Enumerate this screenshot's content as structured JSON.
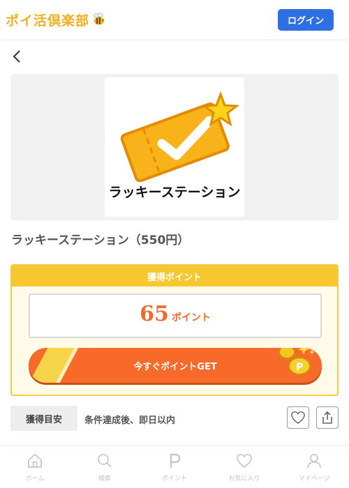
{
  "header": {
    "logo_text": "ポイ活倶楽部",
    "login_label": "ログイン"
  },
  "hero": {
    "caption": "ラッキーステーション"
  },
  "offer": {
    "title": "ラッキーステーション（550円）"
  },
  "points": {
    "heading": "獲得ポイント",
    "value": "65",
    "unit": "ポイント",
    "get_label": "今すぐポイントGET"
  },
  "estimate": {
    "tag": "獲得目安",
    "text": "条件達成後、即日以内"
  },
  "tabbar": {
    "items": [
      {
        "label": "ホーム",
        "icon": "home-icon"
      },
      {
        "label": "検索",
        "icon": "search-icon"
      },
      {
        "label": "ポイント",
        "icon": "point-icon"
      },
      {
        "label": "お気に入り",
        "icon": "heart-icon"
      },
      {
        "label": "マイページ",
        "icon": "person-icon"
      }
    ]
  },
  "colors": {
    "brand_yellow": "#f7c72f",
    "accent_orange": "#f76a2a",
    "login_blue": "#2f6fe4"
  }
}
